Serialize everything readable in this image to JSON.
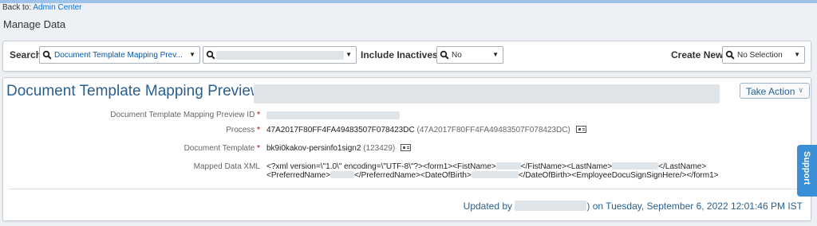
{
  "header": {
    "back_prefix": "Back to: ",
    "back_link": "Admin Center",
    "page_title": "Manage Data"
  },
  "search": {
    "search_label": "Search",
    "type_value": "Document Template Mapping Prev...",
    "include_inactives_label": "Include Inactives:",
    "include_inactives_value": "No",
    "create_new_label": "Create New",
    "create_new_value": "No Selection"
  },
  "record": {
    "title": "Document Template Mapping Preview:",
    "take_action": "Take Action",
    "fields": {
      "id_label": "Document Template Mapping Preview ID",
      "process_label": "Process",
      "process_value": "47A2017F80FF4FA49483507F078423DC",
      "process_sub": "(47A2017F80FF4FA49483507F078423DC)",
      "template_label": "Document Template",
      "template_value": "bk9i0kakov-persinfo1sign2",
      "template_sub": "(123429)",
      "xml_label": "Mapped Data XML",
      "xml_line1_a": "<?xml version=\\\"1.0\\\" encoding=\\\"UTF-8\\\"?><form1><FistName>",
      "xml_line1_b": "</FistName><LastName>",
      "xml_line1_c": "</LastName>",
      "xml_line2_a": "<PreferredName>",
      "xml_line2_b": "</PreferredName><DateOfBirth>",
      "xml_line2_c": "</DateOfBirth><EmployeeDocuSignSignHere/></form1>"
    },
    "updated_prefix": "Updated by",
    "updated_suffix": ") on Tuesday, September 6, 2022 12:01:46 PM IST"
  },
  "support_label": "Support",
  "required_mark": "*",
  "icons": {
    "search": "magnifier-icon",
    "dropdown": "caret-down-icon",
    "details": "card-details-icon",
    "chevron": "chevron-down-icon"
  }
}
